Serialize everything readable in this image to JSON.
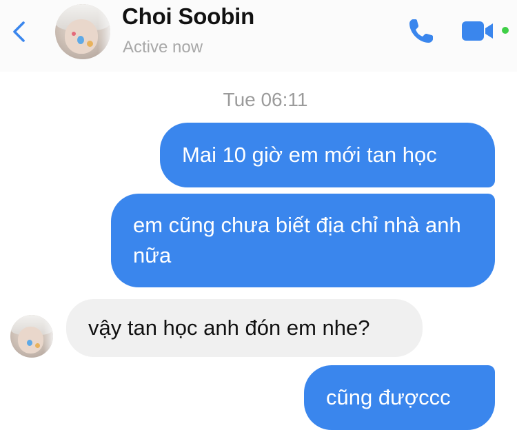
{
  "header": {
    "contact_name": "Choi Soobin",
    "status": "Active now",
    "icons": [
      "back-chevron-icon",
      "phone-icon",
      "video-camera-icon"
    ]
  },
  "colors": {
    "accent": "#3a86ed",
    "incoming_bubble": "#f0f0f0",
    "active_dot": "#3fcf47"
  },
  "conversation": {
    "timestamp": "Tue 06:11",
    "messages": [
      {
        "direction": "outgoing",
        "text": "Mai 10 giờ em mới tan học"
      },
      {
        "direction": "outgoing",
        "text": "em cũng chưa biết địa chỉ nhà anh nữa"
      },
      {
        "direction": "incoming",
        "text": "vậy tan học anh đón em nhe?"
      },
      {
        "direction": "outgoing",
        "text": "cũng đượccc"
      }
    ]
  }
}
